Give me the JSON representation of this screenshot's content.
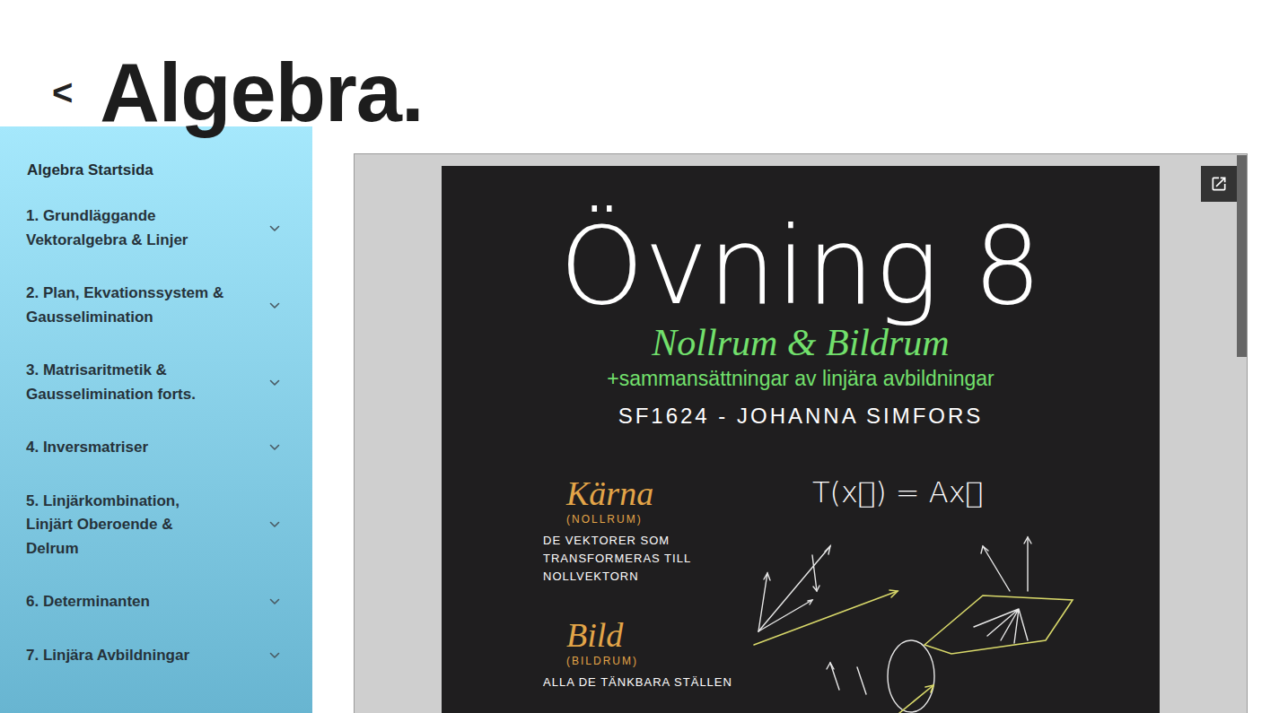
{
  "header": {
    "back": "<",
    "title": "Algebra."
  },
  "sidebar": {
    "home": "Algebra Startsida",
    "items": [
      {
        "lines": [
          "1. Grundläggande",
          "Vektoralgebra & Linjer"
        ],
        "expanded": false
      },
      {
        "lines": [
          "2. Plan, Ekvationssystem &",
          "Gausselimination"
        ],
        "expanded": false
      },
      {
        "lines": [
          "3. Matrisaritmetik &",
          "Gausselimination forts."
        ],
        "expanded": false
      },
      {
        "lines": [
          "4. Inversmatriser"
        ],
        "expanded": false
      },
      {
        "lines": [
          "5. Linjärkombination,",
          "Linjärt Oberoende &",
          "Delrum"
        ],
        "expanded": false
      },
      {
        "lines": [
          "6. Determinanten"
        ],
        "expanded": false
      },
      {
        "lines": [
          "7. Linjära Avbildningar"
        ],
        "expanded": false
      }
    ]
  },
  "viewer": {
    "page": {
      "title": "Övning 8",
      "subtitle": "Nollrum & Bildrum",
      "subtitle2": "+sammansättningar av linjära avbildningar",
      "course": "SF1624 - JOHANNA SIMFORS",
      "formula": "T(x⃗) = Ax⃗",
      "sections": [
        {
          "heading": "Kärna",
          "label": "(NOLLRUM)",
          "lines": [
            "DE VEKTORER SOM",
            "TRANSFORMERAS TILL",
            "NOLLVEKTORN"
          ]
        },
        {
          "heading": "Bild",
          "label": "(BILDRUM)",
          "lines": [
            "ALLA DE TÄNKBARA STÄLLEN"
          ]
        }
      ]
    }
  }
}
